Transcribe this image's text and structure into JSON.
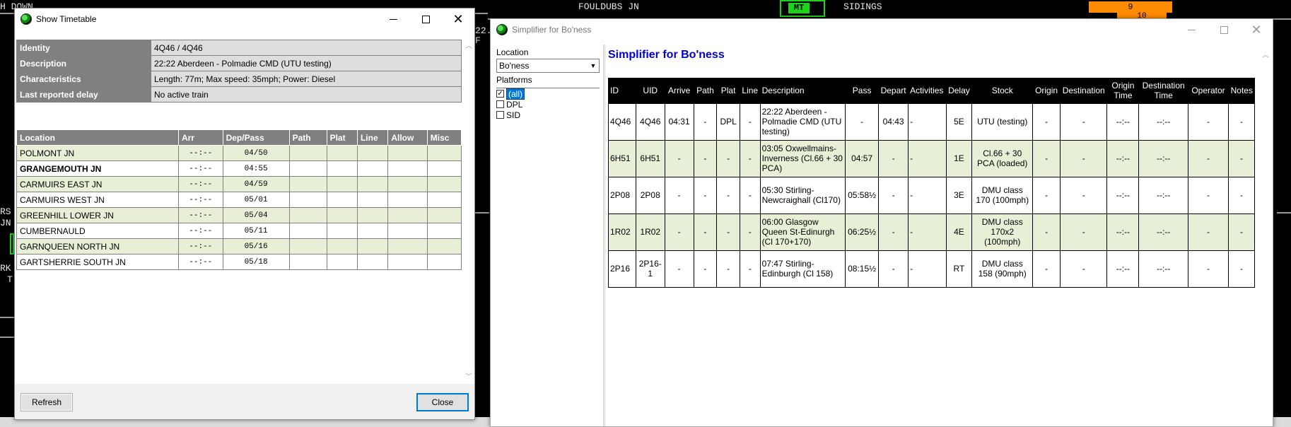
{
  "background": {
    "labels": [
      "H DOWN",
      "FOULDUBS JN",
      "MT",
      "SIDINGS",
      "9",
      "10",
      "22.",
      "F",
      "RS",
      "JN",
      "RK",
      "T"
    ]
  },
  "timetable_window": {
    "title": "Show Timetable",
    "info": [
      {
        "label": "Identity",
        "value": "4Q46 / 4Q46"
      },
      {
        "label": "Description",
        "value": "22:22 Aberdeen - Polmadie CMD (UTU testing)"
      },
      {
        "label": "Characteristics",
        "value": "Length: 77m; Max speed: 35mph; Power: Diesel"
      },
      {
        "label": "Last reported delay",
        "value": "No active train"
      }
    ],
    "columns": [
      "Location",
      "Arr",
      "Dep/Pass",
      "Path",
      "Plat",
      "Line",
      "Allow",
      "Misc"
    ],
    "rows": [
      {
        "location": "POLMONT JN",
        "arr": "--:--",
        "dep": "04/50",
        "bold": false
      },
      {
        "location": "GRANGEMOUTH JN",
        "arr": "--:--",
        "dep": "04:55",
        "bold": true
      },
      {
        "location": "CARMUIRS EAST JN",
        "arr": "--:--",
        "dep": "04/59",
        "bold": false
      },
      {
        "location": "CARMUIRS WEST JN",
        "arr": "--:--",
        "dep": "05/01",
        "bold": false
      },
      {
        "location": "GREENHILL LOWER JN",
        "arr": "--:--",
        "dep": "05/04",
        "bold": false
      },
      {
        "location": "CUMBERNAULD",
        "arr": "--:--",
        "dep": "05/11",
        "bold": false
      },
      {
        "location": "GARNQUEEN NORTH JN",
        "arr": "--:--",
        "dep": "05/16",
        "bold": false
      },
      {
        "location": "GARTSHERRIE SOUTH JN",
        "arr": "--:--",
        "dep": "05/18",
        "bold": false
      }
    ],
    "refresh_label": "Refresh",
    "close_label": "Close"
  },
  "simplifier_window": {
    "title": "Simplifier for Bo'ness",
    "location_label": "Location",
    "location_value": "Bo'ness",
    "platforms_label": "Platforms",
    "platforms": [
      {
        "label": "(all)",
        "checked": true,
        "selected": true
      },
      {
        "label": "DPL",
        "checked": false,
        "selected": false
      },
      {
        "label": "SID",
        "checked": false,
        "selected": false
      }
    ],
    "heading": "Simplifier for Bo'ness",
    "columns": [
      "ID",
      "UID",
      "Arrive",
      "Path",
      "Plat",
      "Line",
      "Description",
      "Pass",
      "Depart",
      "Activities",
      "Delay",
      "Stock",
      "Origin",
      "Destination",
      "Origin Time",
      "Destination Time",
      "Operator",
      "Notes"
    ],
    "rows": [
      [
        "4Q46",
        "4Q46",
        "04:31",
        "-",
        "DPL",
        "-",
        "22:22 Aberdeen - Polmadie CMD (UTU testing)",
        "-",
        "04:43",
        "-",
        "5E",
        "UTU (testing)",
        "-",
        "-",
        "--:--",
        "--:--",
        "-",
        "-"
      ],
      [
        "6H51",
        "6H51",
        "-",
        "-",
        "-",
        "-",
        "03:05 Oxwellmains-Inverness (Cl.66 + 30 PCA)",
        "04:57",
        "-",
        "-",
        "1E",
        "Cl.66 + 30 PCA (loaded)",
        "-",
        "-",
        "--:--",
        "--:--",
        "-",
        "-"
      ],
      [
        "2P08",
        "2P08",
        "-",
        "-",
        "-",
        "-",
        "05:30 Stirling-Newcraighall (Cl170)",
        "05:58½",
        "-",
        "-",
        "3E",
        "DMU class 170 (100mph)",
        "-",
        "-",
        "--:--",
        "--:--",
        "-",
        "-"
      ],
      [
        "1R02",
        "1R02",
        "-",
        "-",
        "-",
        "-",
        "06:00 Glasgow Queen St-Edinurgh (Cl 170+170)",
        "06:25½",
        "-",
        "-",
        "4E",
        "DMU class 170x2 (100mph)",
        "-",
        "-",
        "--:--",
        "--:--",
        "-",
        "-"
      ],
      [
        "2P16",
        "2P16-1",
        "-",
        "-",
        "-",
        "-",
        "07:47 Stirling-Edinburgh (Cl 158)",
        "08:15½",
        "-",
        "-",
        "RT",
        "DMU class 158 (90mph)",
        "-",
        "-",
        "--:--",
        "--:--",
        "-",
        "-"
      ]
    ]
  }
}
